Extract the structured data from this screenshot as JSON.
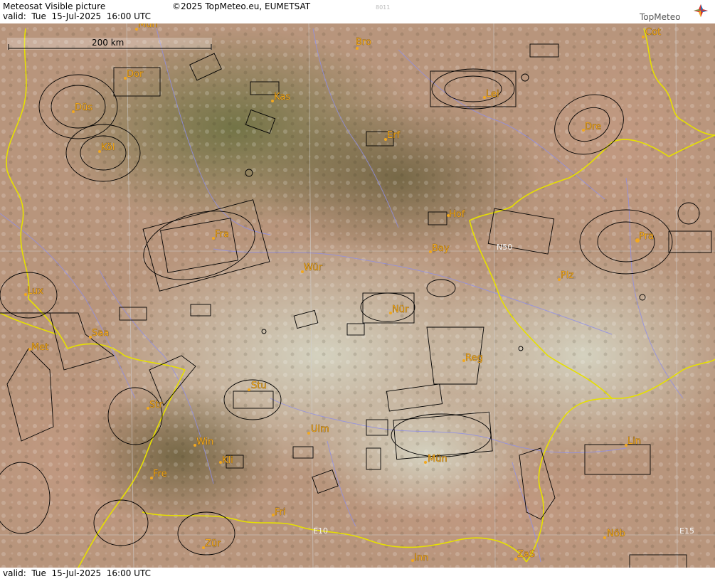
{
  "header": {
    "title": "Meteosat Visible picture",
    "valid": "valid:  Tue  15-Jul-2025  16:00 UTC",
    "copyright": "©2025 TopMeteo.eu, EUMETSAT",
    "code": "8011",
    "logo": "TopMeteo"
  },
  "footer": {
    "valid": "valid:  Tue  15-Jul-2025  16:00 UTC"
  },
  "scale": {
    "label": "200 km"
  },
  "grid": {
    "e10": "E10",
    "e15": "E15",
    "n50": "N50"
  },
  "cities": [
    {
      "name": "Mün"
    },
    {
      "name": "Bro"
    },
    {
      "name": "Cot"
    },
    {
      "name": "Dor"
    },
    {
      "name": "Düs"
    },
    {
      "name": "Kas"
    },
    {
      "name": "Lei"
    },
    {
      "name": "Erf"
    },
    {
      "name": "Köl"
    },
    {
      "name": "Dre"
    },
    {
      "name": "Fra"
    },
    {
      "name": "Hof"
    },
    {
      "name": "Pra"
    },
    {
      "name": "Bay"
    },
    {
      "name": "Wür"
    },
    {
      "name": "Plz"
    },
    {
      "name": "Lux"
    },
    {
      "name": "Nür"
    },
    {
      "name": "Saa"
    },
    {
      "name": "Met"
    },
    {
      "name": "Reg"
    },
    {
      "name": "Stu"
    },
    {
      "name": "Str"
    },
    {
      "name": "Ulm"
    },
    {
      "name": "Win"
    },
    {
      "name": "Kli"
    },
    {
      "name": "Mün"
    },
    {
      "name": "Lin"
    },
    {
      "name": "Fre"
    },
    {
      "name": "Fri"
    },
    {
      "name": "Zür"
    },
    {
      "name": "Inn"
    },
    {
      "name": "ZaS"
    },
    {
      "name": "Nöb"
    }
  ],
  "colors": {
    "border": "#e6e000",
    "river": "#8f8fe8",
    "airspace": "#000000",
    "city": "#f2a81f"
  }
}
